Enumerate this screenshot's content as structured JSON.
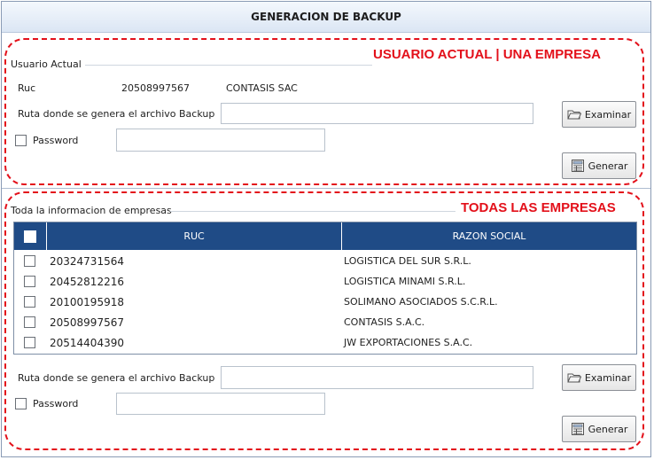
{
  "window": {
    "title": "GENERACION DE BACKUP"
  },
  "annotations": {
    "top": "USUARIO ACTUAL | UNA EMPRESA",
    "bottom": "TODAS LAS EMPRESAS",
    "color": "#e3101a"
  },
  "current_user": {
    "group_label": "Usuario Actual",
    "ruc_label": "Ruc",
    "ruc_value": "20508997567",
    "company_name": "CONTASIS SAC",
    "path_label": "Ruta donde se genera el archivo Backup",
    "path_value": "",
    "password_label": "Password",
    "password_value": "",
    "browse_label": "Examinar",
    "generate_label": "Generar"
  },
  "all_companies": {
    "group_label": "Toda la informacion de empresas",
    "columns": [
      "RUC",
      "RAZON SOCIAL"
    ],
    "header_color": "#1f4b86",
    "rows": [
      {
        "ruc": "20324731564",
        "razon_social": "LOGISTICA DEL SUR S.R.L."
      },
      {
        "ruc": "20452812216",
        "razon_social": "LOGISTICA MINAMI S.R.L."
      },
      {
        "ruc": "20100195918",
        "razon_social": "SOLIMANO ASOCIADOS S.C.R.L."
      },
      {
        "ruc": "20508997567",
        "razon_social": "CONTASIS S.A.C."
      },
      {
        "ruc": "20514404390",
        "razon_social": "JW EXPORTACIONES S.A.C."
      }
    ],
    "path_label": "Ruta donde se genera el archivo Backup",
    "path_value": "",
    "password_label": "Password",
    "password_value": "",
    "browse_label": "Examinar",
    "generate_label": "Generar"
  },
  "icons": {
    "browse": "folder-open-icon",
    "generate": "generate-backup-icon"
  }
}
